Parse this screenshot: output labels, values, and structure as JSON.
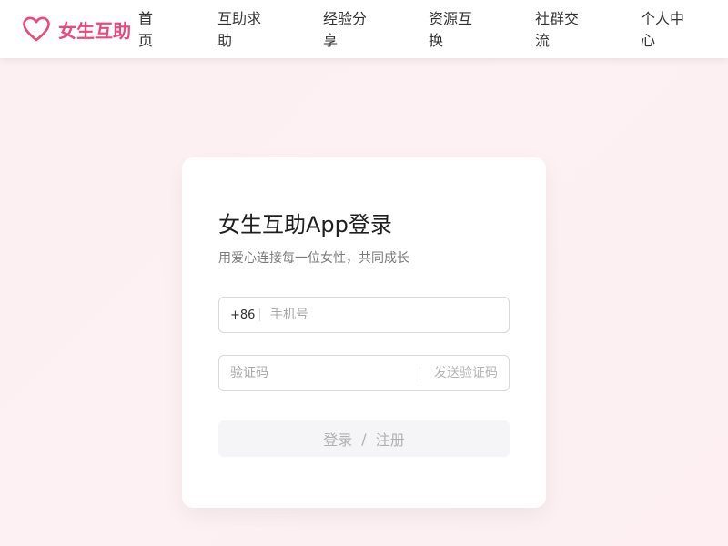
{
  "header": {
    "brand_name": "女生互助",
    "brand_icon": "heart-icon",
    "brand_color": "#e94a7a",
    "nav": [
      {
        "label": "首页"
      },
      {
        "label": "互助求助"
      },
      {
        "label": "经验分享"
      },
      {
        "label": "资源互换"
      },
      {
        "label": "社群交流"
      },
      {
        "label": "个人中心"
      }
    ]
  },
  "login": {
    "title": "女生互助App登录",
    "subtitle": "用爱心连接每一位女性，共同成长",
    "phone": {
      "prefix": "+86",
      "value": "",
      "placeholder": "手机号"
    },
    "code": {
      "value": "",
      "placeholder": "验证码",
      "send_label": "发送验证码"
    },
    "submit": {
      "login_label": "登录",
      "separator": "/",
      "register_label": "注册",
      "state": "disabled"
    }
  }
}
